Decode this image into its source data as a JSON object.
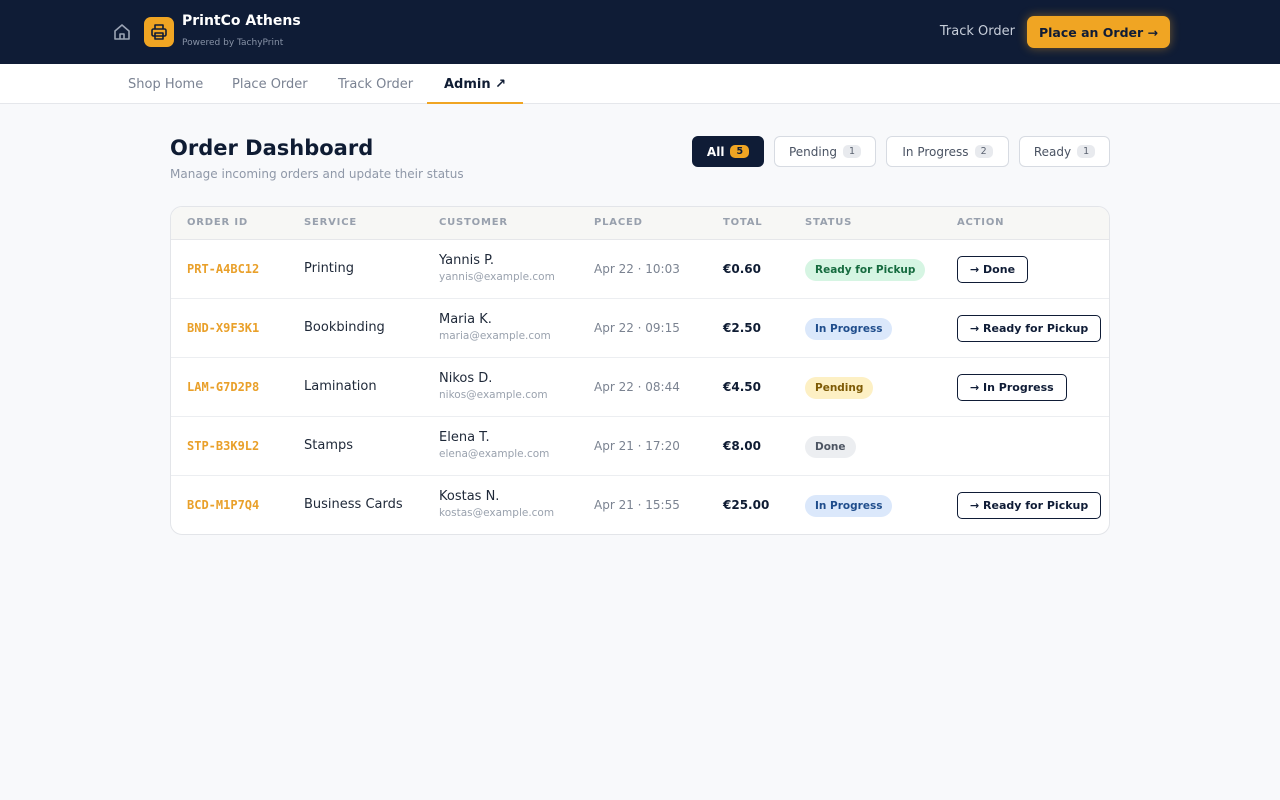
{
  "header": {
    "brand": "PrintCo Athens",
    "powered_by": "Powered by TachyPrint",
    "track_link": "Track Order",
    "cta": "Place an Order →"
  },
  "nav": {
    "tabs": [
      {
        "label": "Shop Home"
      },
      {
        "label": "Place Order"
      },
      {
        "label": "Track Order"
      },
      {
        "label": "Admin ↗",
        "active": true
      }
    ]
  },
  "page": {
    "title": "Order Dashboard",
    "subtitle": "Manage incoming orders and update their status"
  },
  "filters": [
    {
      "label": "All",
      "count": "5",
      "active": true
    },
    {
      "label": "Pending",
      "count": "1"
    },
    {
      "label": "In Progress",
      "count": "2"
    },
    {
      "label": "Ready",
      "count": "1"
    }
  ],
  "table": {
    "columns": [
      "ORDER ID",
      "SERVICE",
      "CUSTOMER",
      "PLACED",
      "TOTAL",
      "STATUS",
      "ACTION"
    ],
    "rows": [
      {
        "id": "PRT-A4BC12",
        "service": "Printing",
        "name": "Yannis P.",
        "email": "yannis@example.com",
        "placed": "Apr 22 · 10:03",
        "total": "€0.60",
        "status": "Ready for Pickup",
        "action": "→ Done"
      },
      {
        "id": "BND-X9F3K1",
        "service": "Bookbinding",
        "name": "Maria K.",
        "email": "maria@example.com",
        "placed": "Apr 22 · 09:15",
        "total": "€2.50",
        "status": "In Progress",
        "action": "→ Ready for Pickup"
      },
      {
        "id": "LAM-G7D2P8",
        "service": "Lamination",
        "name": "Nikos D.",
        "email": "nikos@example.com",
        "placed": "Apr 22 · 08:44",
        "total": "€4.50",
        "status": "Pending",
        "action": "→ In Progress"
      },
      {
        "id": "STP-B3K9L2",
        "service": "Stamps",
        "name": "Elena T.",
        "email": "elena@example.com",
        "placed": "Apr 21 · 17:20",
        "total": "€8.00",
        "status": "Done",
        "action": ""
      },
      {
        "id": "BCD-M1P7Q4",
        "service": "Business Cards",
        "name": "Kostas N.",
        "email": "kostas@example.com",
        "placed": "Apr 21 · 15:55",
        "total": "€25.00",
        "status": "In Progress",
        "action": "→ Ready for Pickup"
      }
    ]
  },
  "colors": {
    "navy": "#0f1c36",
    "accent": "#f0a523",
    "ready": "#d6f5e3",
    "in_progress": "#dbe8fb",
    "pending": "#fdf0c4",
    "done": "#eceef1"
  },
  "icons": {
    "home": "home-icon",
    "logo": "printer-icon"
  }
}
